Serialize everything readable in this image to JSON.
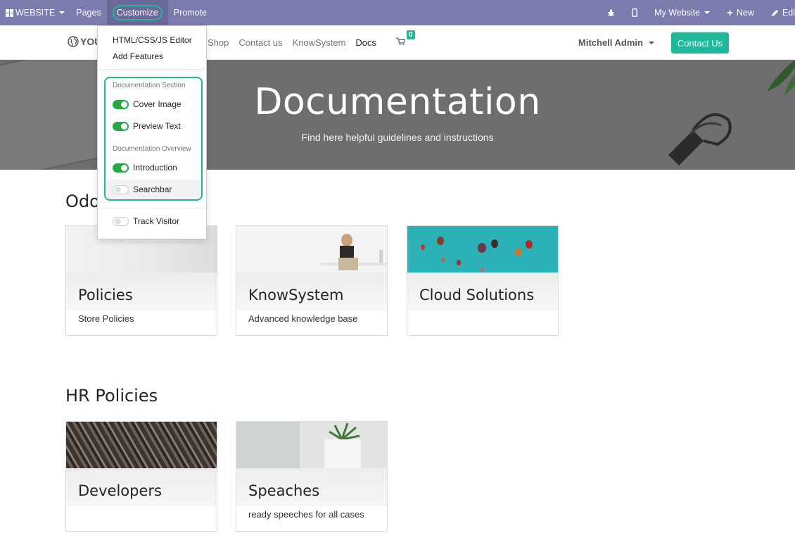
{
  "adminbar": {
    "website": "WEBSITE",
    "pages": "Pages",
    "customize": "Customize",
    "promote": "Promote",
    "my_website": "My Website",
    "new": "New",
    "edit": "Edi"
  },
  "navbar": {
    "logo_text": "YOU",
    "links": [
      "Shop",
      "Contact us",
      "KnowSystem",
      "Docs"
    ],
    "cart_count": "0",
    "user": "Mitchell Admin",
    "contact_button": "Contact Us"
  },
  "hero": {
    "title": "Documentation",
    "subtitle": "Find here helpful guidelines and instructions"
  },
  "customize_menu": {
    "html_editor": "HTML/CSS/JS Editor",
    "add_features": "Add Features",
    "doc_section_header": "Documentation Section",
    "cover_image": "Cover Image",
    "preview_text": "Preview Text",
    "doc_overview_header": "Documentation Overview",
    "introduction": "Introduction",
    "searchbar": "Searchbar",
    "track_visitor": "Track Visitor"
  },
  "sections": [
    {
      "title": "Odo",
      "cards": [
        {
          "title": "Policies",
          "subtitle": "Store Policies"
        },
        {
          "title": "KnowSystem",
          "subtitle": "Advanced knowledge base"
        },
        {
          "title": "Cloud Solutions",
          "subtitle": ""
        }
      ]
    },
    {
      "title": "HR Policies",
      "cards": [
        {
          "title": "Developers",
          "subtitle": ""
        },
        {
          "title": "Speaches",
          "subtitle": "ready speeches for all cases"
        }
      ]
    }
  ],
  "colors": {
    "adminbar": "#7c7bad",
    "accent": "#21b799",
    "toggle_on": "#28a745"
  }
}
